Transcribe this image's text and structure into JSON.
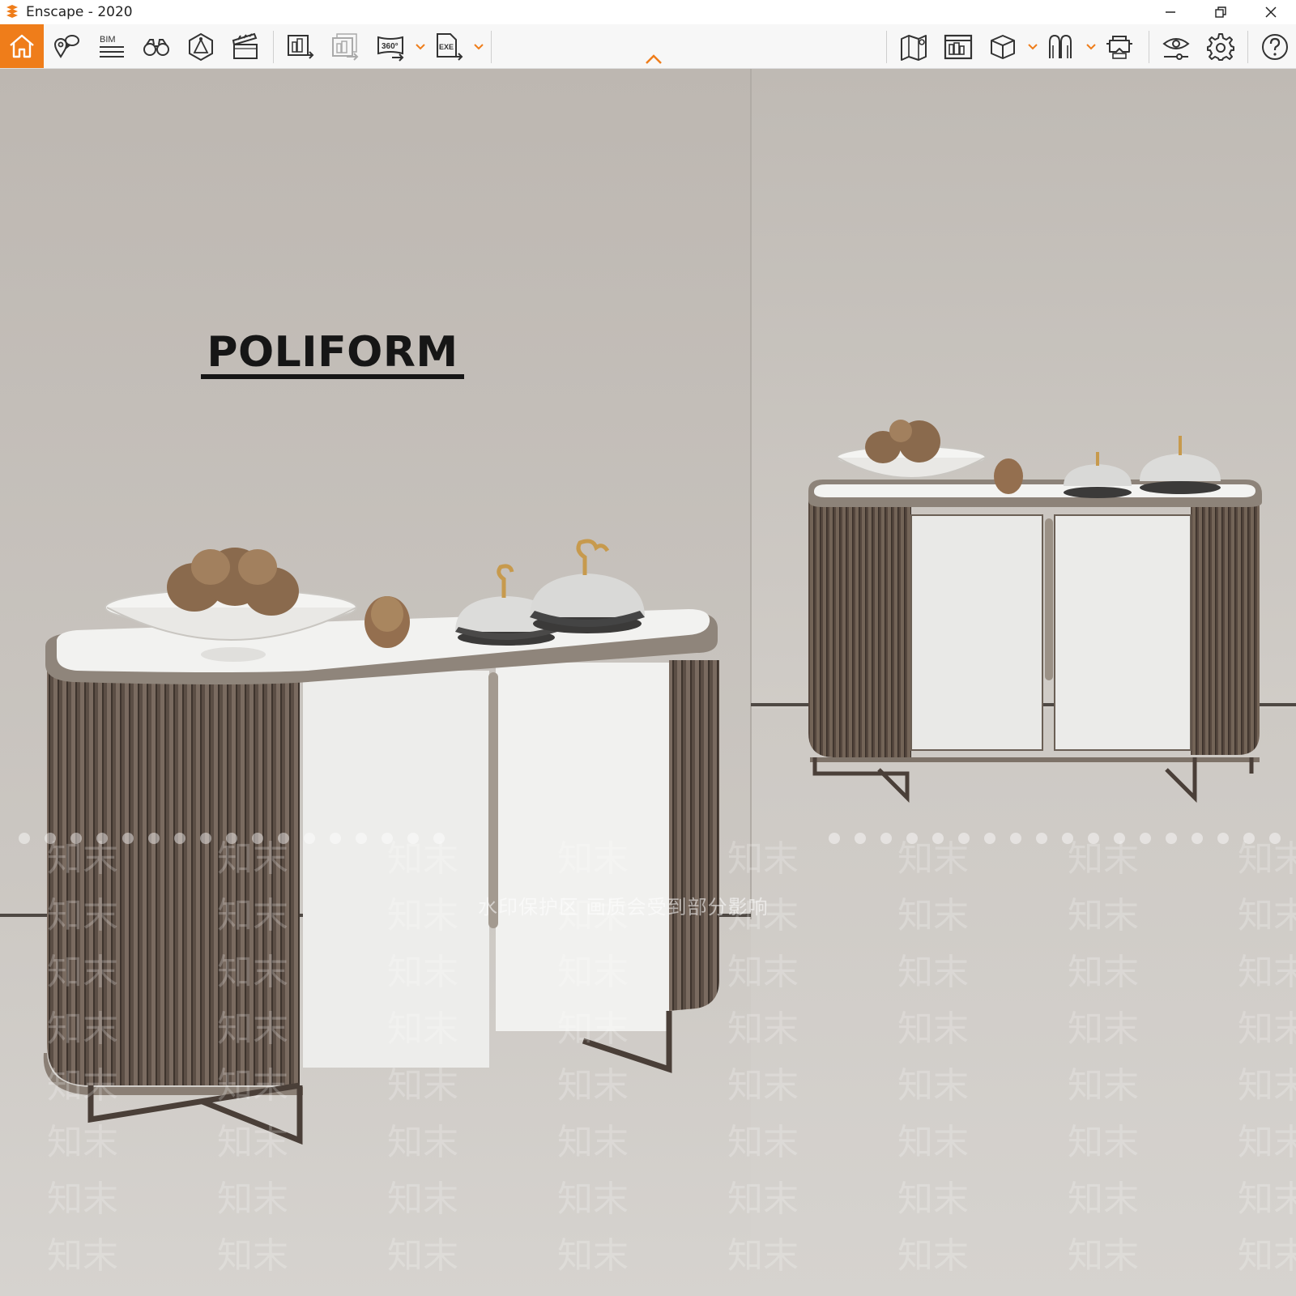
{
  "window": {
    "title": "Enscape - 2020",
    "controls": [
      "minimize-icon",
      "restore-icon",
      "close-icon"
    ]
  },
  "toolbar": {
    "accent": "#ef7d1a",
    "left_tools": [
      "home-icon",
      "pin-comment-icon",
      "bim-list-icon",
      "binoculars-icon",
      "camera-view-icon",
      "clapperboard-icon",
      "render-export-icon",
      "batch-render-icon",
      "panorama-360-icon",
      "exe-export-icon"
    ],
    "right_tools": [
      "map-icon",
      "asset-library-icon",
      "cube-icon",
      "walk-mode-icon",
      "vr-headset-icon",
      "visual-settings-icon",
      "settings-icon",
      "help-icon"
    ],
    "bim_label": "BIM",
    "pano_label": "360°",
    "exe_label": "EXE"
  },
  "scene": {
    "brand": "POLIFORM",
    "watermark_text": "水印保护区  画质会受到部分影响",
    "watermark_glyph": "知末"
  }
}
